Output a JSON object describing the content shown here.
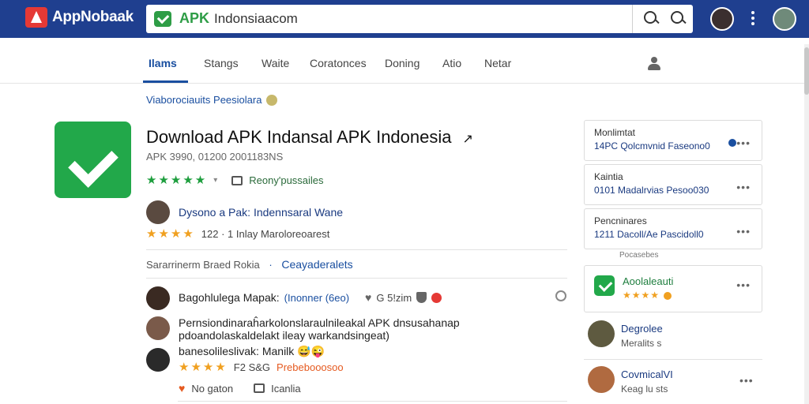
{
  "header": {
    "brand": "AppNobaak",
    "search_prefix": "APK",
    "search_value": "Indonsiaacom"
  },
  "tabs": [
    {
      "label": "Ilams"
    },
    {
      "label": "Stangs"
    },
    {
      "label": "Waite"
    },
    {
      "label": "Coratonces"
    },
    {
      "label": "Doning"
    },
    {
      "label": "Atio"
    },
    {
      "label": "Netar"
    }
  ],
  "breadcrumb": "Viaborociauits Peesiolara",
  "app": {
    "title": "Download APK Indansal APK Indonesia",
    "title_icon": "↗",
    "subtitle": "APK 3990, 01200 2001183NS",
    "stars": "★★★★★",
    "reviews_label": "Reony'pussailes",
    "developer": "Dysono a Pak: Indennsaral Wane",
    "rating_stars": "★★★★",
    "rating_text": "122 · 1 Inlay Maroloreoarest",
    "section_label": "Sararrinerm Braed Rokia",
    "section_accent": "Ceayaderalets"
  },
  "reviews": [
    {
      "text": "Bagohlulega Mapak:",
      "tag": "(Inonner (6eo)",
      "meta": "G 5!zim"
    },
    {
      "line1": "Pernsiondinaraĥarkolonslaraulnileakal APK dnsusahanap",
      "line2": "pdoandolaskaldelakt ileay warkandsingeat)",
      "line3": "banesolileslivak: Manilk 😅😜"
    },
    {
      "stars": "★★★★",
      "meta": "F2 S&G",
      "highlight": "Prebebooosoo"
    }
  ],
  "actions": {
    "like": "No gaton",
    "comment": "Icanlia"
  },
  "sidebar": {
    "cards": [
      {
        "label": "Monlimtat",
        "value": "14PC Qolcmvnid Faseono0"
      },
      {
        "label": "Kaintia",
        "value": "0101 Madalrvias Pesoo030"
      },
      {
        "label": "Pencninares",
        "value": "1211 Dacoll/Ae Pascidoll0"
      }
    ],
    "note": "Pocasebes",
    "app_card": {
      "title": "Aoolaleauti",
      "stars": "★★★★"
    },
    "people": [
      {
        "name": "Degrolee",
        "sub": "Meralits s"
      },
      {
        "name": "CovmicalVI",
        "sub": "Keag lu sts"
      }
    ]
  },
  "colors": {
    "brand_bar": "#1f3f8f",
    "accent": "#1a4fa0",
    "green": "#22a84a",
    "star_green": "#1e9e3e",
    "star_orange": "#f0a020"
  }
}
